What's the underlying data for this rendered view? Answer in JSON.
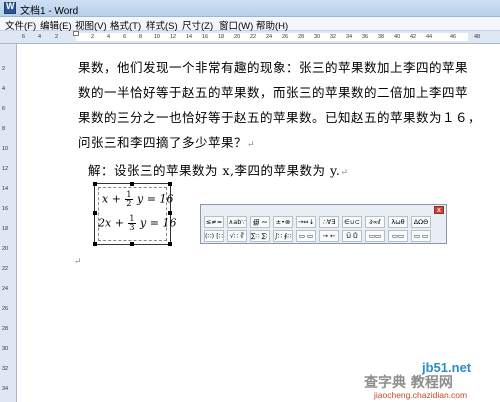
{
  "window": {
    "title": "文档1 - Word"
  },
  "menu": [
    "文件(F)",
    "编辑(E)",
    "视图(V)",
    "格式(T)",
    "样式(S)",
    "尺寸(Z)",
    "窗口(W)",
    "帮助(H)"
  ],
  "ruler": {
    "h_ticks": [
      "6",
      "4",
      "2",
      "2",
      "4",
      "6",
      "8",
      "10",
      "12",
      "14",
      "16",
      "18",
      "20",
      "22",
      "24",
      "26",
      "28",
      "30",
      "32",
      "34",
      "36",
      "38",
      "40",
      "42",
      "44",
      "46",
      "48"
    ],
    "v_ticks": [
      "2",
      "4",
      "6",
      "8",
      "10",
      "12",
      "14",
      "16",
      "18",
      "20",
      "22",
      "24",
      "26",
      "28",
      "30",
      "32",
      "34"
    ]
  },
  "document": {
    "paragraphs": [
      "果数，他们发现一个非常有趣的现象：张三的苹果数加上李四的苹果",
      "数的一半恰好等于赵五的苹果数，而张三的苹果数的二倍加上李四苹",
      "果数的三分之一也恰好等于赵五的苹果数。已知赵五的苹果数为１６，",
      "问张三和李四摘了多少苹果？"
    ],
    "solution": "解：设张三的苹果数为 x,李四的苹果数为 y.",
    "paragraph_mark": "↵"
  },
  "equations": [
    {
      "left": "x +",
      "num": "1",
      "den": "2",
      "right": "y = 16"
    },
    {
      "left": "2x +",
      "num": "1",
      "den": "3",
      "right": "y = 16"
    }
  ],
  "math_toolbar": {
    "close": "x",
    "row1": [
      "≤≠≈",
      "∧ab∵",
      "∰ ∾",
      "±•⊗",
      "→⇔↓",
      "∴∀∃",
      "∈∪⊂",
      "∂∞ℓ",
      "λωθ",
      "ΔΩΘ"
    ],
    "row2": [
      "(∷) [∷]",
      "√∷ ∛",
      "∑∷ ∑∷",
      "∫∷ ∮∷",
      "▭ ▭",
      "→ ←",
      "Ū Ů",
      "▭▭",
      "▭▭",
      "▭ ▭"
    ]
  },
  "watermark": {
    "site": "jb51.net",
    "brand": "查字典 教程网",
    "url": "jiaocheng.chazidian.com"
  }
}
